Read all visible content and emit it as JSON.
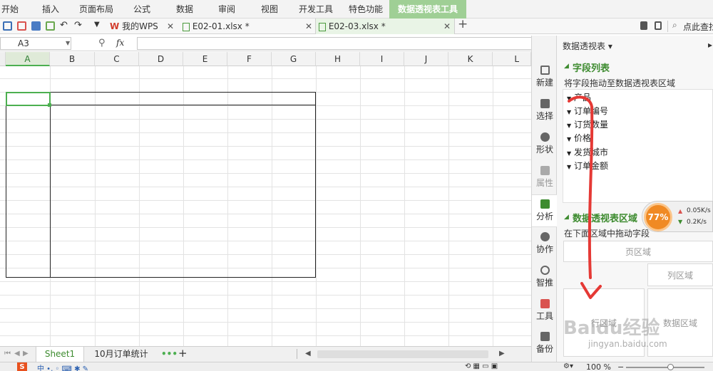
{
  "ribbon": {
    "tabs": [
      "开始",
      "插入",
      "页面布局",
      "公式",
      "数据",
      "审阅",
      "视图",
      "开发工具",
      "特色功能",
      "数据透视表工具"
    ],
    "active_tab": "数据透视表工具"
  },
  "quickbar": {
    "doc_tabs": [
      {
        "label": "我的WPS",
        "active": false
      },
      {
        "label": "E02-01.xlsx *",
        "active": false
      },
      {
        "label": "E02-03.xlsx *",
        "active": true
      }
    ],
    "add_tab": "+",
    "search_label": "点此查找"
  },
  "formula_bar": {
    "name_box": "A3",
    "zoom_icon": "magnifier-icon",
    "fx": "fx",
    "formula": ""
  },
  "grid": {
    "columns": [
      "A",
      "B",
      "C",
      "D",
      "E",
      "F",
      "G",
      "H",
      "I",
      "J",
      "K",
      "L"
    ],
    "selected_column": "A",
    "selected_cell": "A3"
  },
  "sheets": {
    "tabs": [
      {
        "label": "Sheet1",
        "active": true
      },
      {
        "label": "10月订单统计",
        "active": false
      }
    ],
    "more": "•••",
    "add": "+"
  },
  "status": {
    "zoom": "100 %"
  },
  "rail": {
    "items": [
      {
        "label": "新建",
        "icon": "new-icon"
      },
      {
        "label": "选择",
        "icon": "select-icon"
      },
      {
        "label": "形状",
        "icon": "shape-icon"
      },
      {
        "label": "属性",
        "icon": "property-icon"
      },
      {
        "label": "分析",
        "icon": "analysis-icon"
      },
      {
        "label": "协作",
        "icon": "collab-icon"
      },
      {
        "label": "智推",
        "icon": "recommend-icon"
      },
      {
        "label": "工具",
        "icon": "toolbox-icon"
      },
      {
        "label": "备份",
        "icon": "backup-icon"
      }
    ]
  },
  "pane": {
    "header": "数据透视表 ▾",
    "field_list_title": "字段列表",
    "field_hint": "将字段拖动至数据透视表区域",
    "fields": [
      "产品",
      "订单编号",
      "订货数量",
      "价格",
      "发货城市",
      "订单金额"
    ],
    "area_title": "数据透视表区域",
    "area_hint": "在下面区域中拖动字段",
    "zones": {
      "page": "页区域",
      "column": "列区域",
      "row": "行区域",
      "data": "数据区域"
    }
  },
  "speed_widget": {
    "percent": "77%",
    "up": "0.05K/s",
    "down": "0.2K/s"
  },
  "watermark": {
    "logo": "Baidu经验",
    "url": "jingyan.baidu.com"
  },
  "colors": {
    "ribbon_active": "#9fcf95",
    "accent_green": "#3d8b2f",
    "arrow_red": "#e53935",
    "orange": "#f08a24"
  }
}
